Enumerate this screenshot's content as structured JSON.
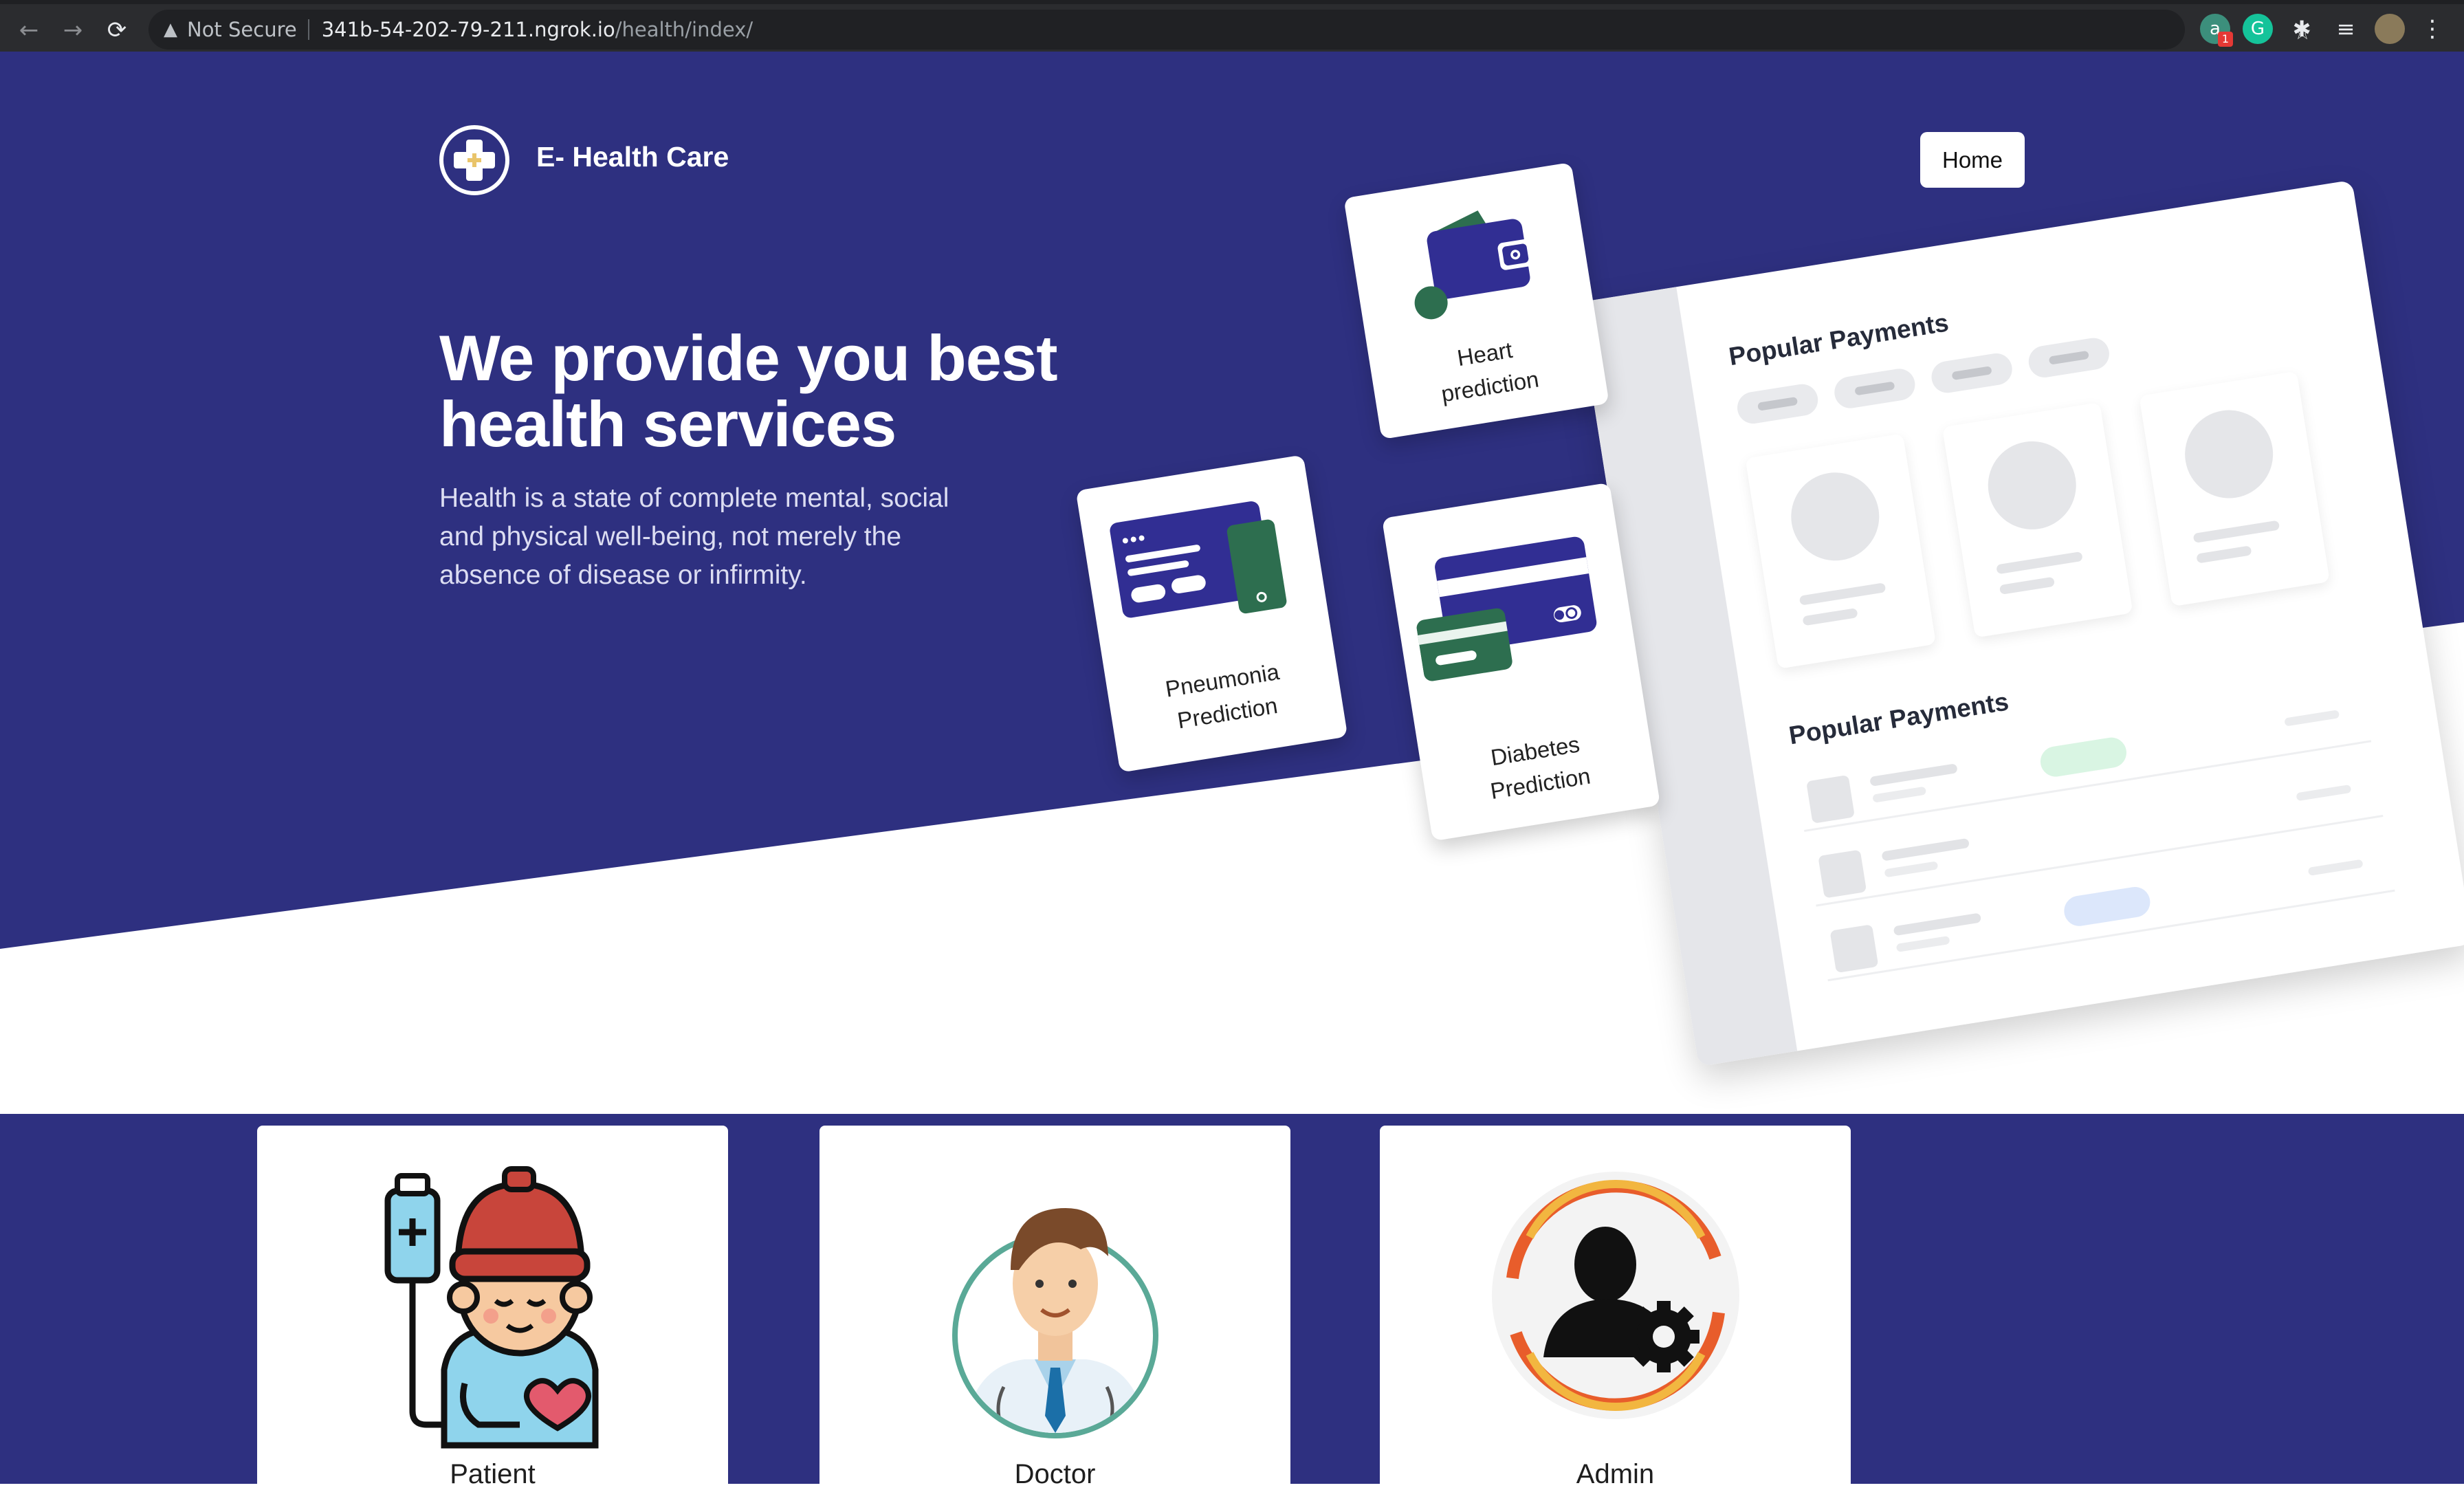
{
  "browser": {
    "security_label": "Not Secure",
    "url_host": "341b-54-202-79-211.ngrok.io",
    "url_path": "/health/index/"
  },
  "brand": {
    "name": "E- Health Care"
  },
  "nav": {
    "home_label": "Home"
  },
  "hero": {
    "headline_line1": "We provide you best",
    "headline_line2": "health services",
    "subtext": "Health is a state of complete mental, social and physical well-being, not merely the absence of disease or infirmity."
  },
  "illustration": {
    "panel_title_1": "Popular Payments",
    "panel_title_2": "Popular Payments",
    "cards": [
      {
        "line1": "Heart",
        "line2": "prediction"
      },
      {
        "line1": "Pneumonia",
        "line2": "Prediction"
      },
      {
        "line1": "Diabetes",
        "line2": "Prediction"
      }
    ]
  },
  "roles": [
    {
      "label": "Patient"
    },
    {
      "label": "Doctor"
    },
    {
      "label": "Admin"
    }
  ],
  "colors": {
    "primary": "#2e3080",
    "card_purple": "#312e93",
    "card_green": "#2d6e4f",
    "accent_orange": "#e85d2b",
    "accent_yellow": "#f2b640"
  }
}
